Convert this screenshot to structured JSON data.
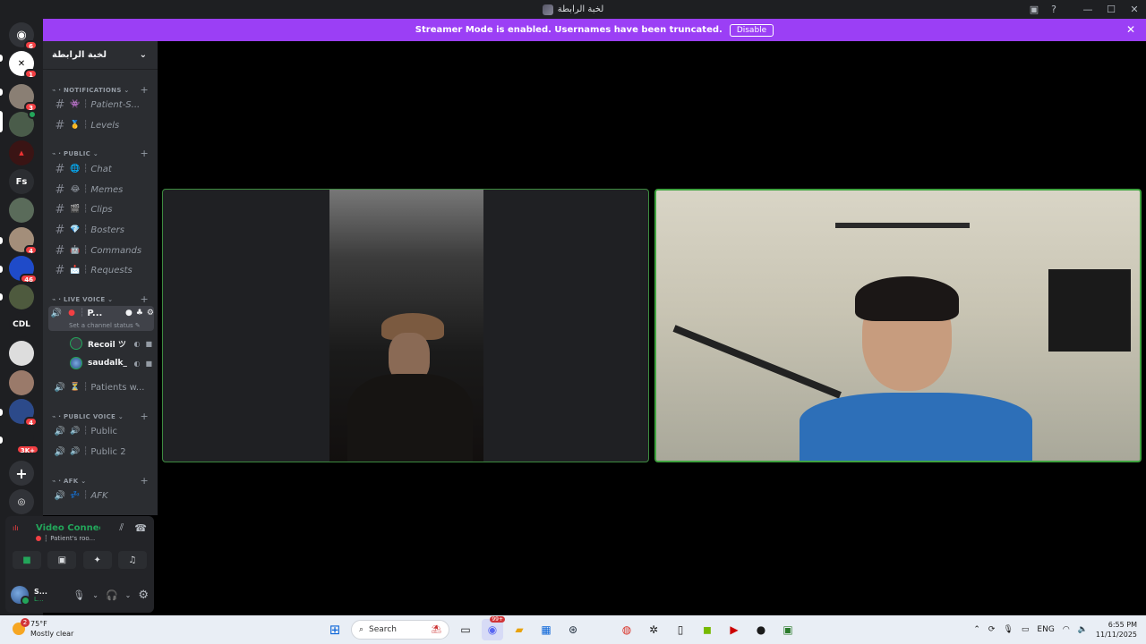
{
  "window": {
    "title": "لخبة الرابطة"
  },
  "banner": {
    "text": "Streamer Mode is enabled. Usernames have been truncated.",
    "disable_label": "Disable"
  },
  "rail": {
    "dm_badge": "6",
    "server_badges": [
      "1",
      "3",
      "4",
      "46",
      "4",
      "3K+"
    ],
    "fs_label": "Fs",
    "cdl_label": "CDL"
  },
  "guild": {
    "name": "لخبة الرابطة",
    "categories": {
      "notifications": "NOTIFICATIONS",
      "public": "PUBLIC",
      "live_voice": "LIVE VOICE",
      "public_voice": "PUBLIC VOICE",
      "afk": "AFK"
    },
    "channels": {
      "patient": "Patient-S...",
      "levels": "Levels",
      "chat": "Chat",
      "memes": "Memes",
      "clips": "Clips",
      "bosters": "Bosters",
      "commands": "Commands",
      "requests": "Requests",
      "live_room": "P...",
      "live_status": "Set a channel status",
      "patients_waiting": "Patients w...",
      "public_vc": "Public",
      "public2_vc": "Public 2",
      "afk_vc": "AFK"
    },
    "members": [
      {
        "name": "Recoil ツ"
      },
      {
        "name": "saudalk_"
      }
    ]
  },
  "voice": {
    "status": "Video Connected",
    "channel": "Patient's roo...",
    "user_name": "S...",
    "user_sub": "L..."
  },
  "taskbar": {
    "weather_temp": "75°F",
    "weather_desc": "Mostly clear",
    "weather_badge": "2",
    "search_placeholder": "Search",
    "lang": "ENG",
    "time": "6:55 PM",
    "date": "11/11/2025",
    "discord_badge": "99+"
  },
  "colors": {
    "banner": "#9b3ff5",
    "connected": "#23a55a",
    "badge": "#f23f43",
    "speaking_border": "#3fa33f"
  }
}
